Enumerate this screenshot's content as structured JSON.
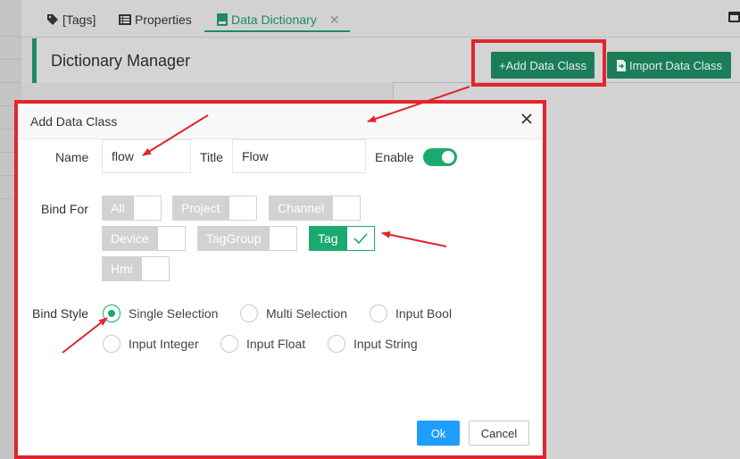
{
  "tabs": [
    {
      "label": "[Tags]",
      "icon": "tags-icon"
    },
    {
      "label": "Properties",
      "icon": "list-icon"
    },
    {
      "label": "Data Dictionary",
      "icon": "book-icon",
      "active": true,
      "closable": true
    }
  ],
  "page": {
    "title": "Dictionary Manager"
  },
  "toolbar": {
    "add_label": "+Add Data Class",
    "import_label": "Import Data Class"
  },
  "modal": {
    "title": "Add Data Class",
    "name_label": "Name",
    "name_value": "flow",
    "title_label": "Title",
    "title_value": "Flow",
    "enable_label": "Enable",
    "enable_on": true,
    "bind_for_label": "Bind For",
    "bind_for": [
      {
        "label": "All",
        "checked": false
      },
      {
        "label": "Project",
        "checked": false
      },
      {
        "label": "Channel",
        "checked": false
      },
      {
        "label": "Device",
        "checked": false
      },
      {
        "label": "TagGroup",
        "checked": false
      },
      {
        "label": "Tag",
        "checked": true
      },
      {
        "label": "Hmi",
        "checked": false
      }
    ],
    "bind_style_label": "Bind Style",
    "bind_style": [
      {
        "label": "Single Selection",
        "selected": true
      },
      {
        "label": "Multi Selection",
        "selected": false
      },
      {
        "label": "Input Bool",
        "selected": false
      },
      {
        "label": "Input Integer",
        "selected": false
      },
      {
        "label": "Input Float",
        "selected": false
      },
      {
        "label": "Input String",
        "selected": false
      }
    ],
    "ok_label": "Ok",
    "cancel_label": "Cancel"
  },
  "colors": {
    "accent": "#1aaa6f",
    "highlight": "#e3242b",
    "primary_button": "#1e9fff"
  }
}
